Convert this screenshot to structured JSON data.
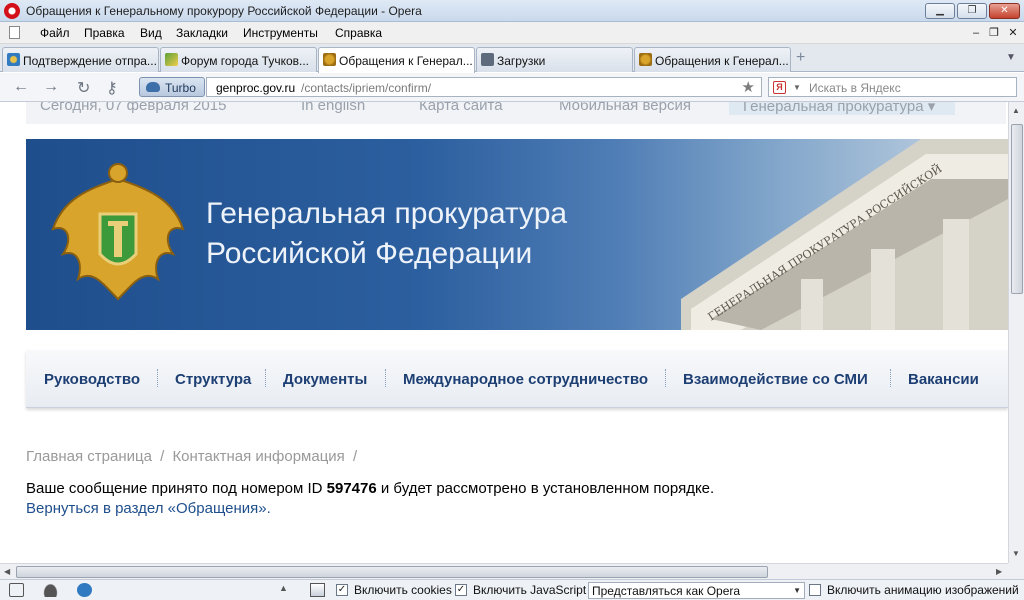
{
  "window": {
    "title": "Обращения к Генеральному прокурору Российской Федерации - Opera",
    "minimize": "▁",
    "restore": "❐",
    "close": "✕"
  },
  "menu": {
    "items": [
      "Файл",
      "Правка",
      "Вид",
      "Закладки",
      "Инструменты",
      "Справка"
    ],
    "mdi": {
      "minimize": "–",
      "restore": "❐",
      "close": "✕"
    }
  },
  "tabs": [
    {
      "label": "Подтверждение отпра...",
      "active": false,
      "icon": "globe-icon"
    },
    {
      "label": "Форум города Тучков...",
      "active": false,
      "icon": "map-icon"
    },
    {
      "label": "Обращения к Генерал...",
      "active": true,
      "icon": "emblem-icon"
    },
    {
      "label": "Загрузки",
      "active": false,
      "icon": "download-icon"
    },
    {
      "label": "Обращения к Генерал...",
      "active": false,
      "icon": "emblem-icon"
    }
  ],
  "tabbar": {
    "new_tab": "+",
    "tab_menu": "▼"
  },
  "navbar": {
    "back": "←",
    "forward": "→",
    "reload": "↻",
    "key": "⚷",
    "turbo_label": "Turbo",
    "url_domain": "genproc.gov.ru",
    "url_path": "/contacts/ipriem/confirm/",
    "star": "★",
    "search_ya": "Я",
    "search_drop": "▼",
    "search_placeholder": "Искать в Яндекс"
  },
  "site": {
    "top_strip": {
      "date": "Сегодня, 07 февраля 2015",
      "english": "In english",
      "sitemap": "Карта сайта",
      "mobile": "Мобильная версия",
      "prosecution": "Генеральная прокуратура"
    },
    "banner": {
      "title_line1": "Генеральная прокуратура",
      "title_line2": "Российской Федерации",
      "building_inscription": "ГЕНЕРАЛЬНАЯ ПРОКУРАТУРА РОССИЙСКОЙ"
    },
    "nav": [
      "Руководство",
      "Структура",
      "Документы",
      "Международное сотрудничество",
      "Взаимодействие со СМИ",
      "Вакансии"
    ],
    "breadcrumb": [
      "Главная страница",
      "/",
      "Контактная информация",
      "/"
    ],
    "message": {
      "before": "Ваше сообщение принято под номером ID ",
      "id": "597476",
      "after": " и будет рассмотрено в установленном порядке."
    },
    "back_link": "Вернуться в раздел «Обращения»."
  },
  "statusbar": {
    "cookies_label": "Включить cookies",
    "cookies_checked": true,
    "js_label": "Включить JavaScript",
    "js_checked": true,
    "identify_as": "Представляться как Opera",
    "animation_label": "Включить анимацию изображений",
    "animation_checked": false,
    "check_mark": "✓",
    "upload": "▲",
    "select_arrow": "▼"
  },
  "colors": {
    "banner_blue": "#1f4e8c",
    "nav_text": "#1d3f73",
    "opera_red": "#d31019"
  }
}
